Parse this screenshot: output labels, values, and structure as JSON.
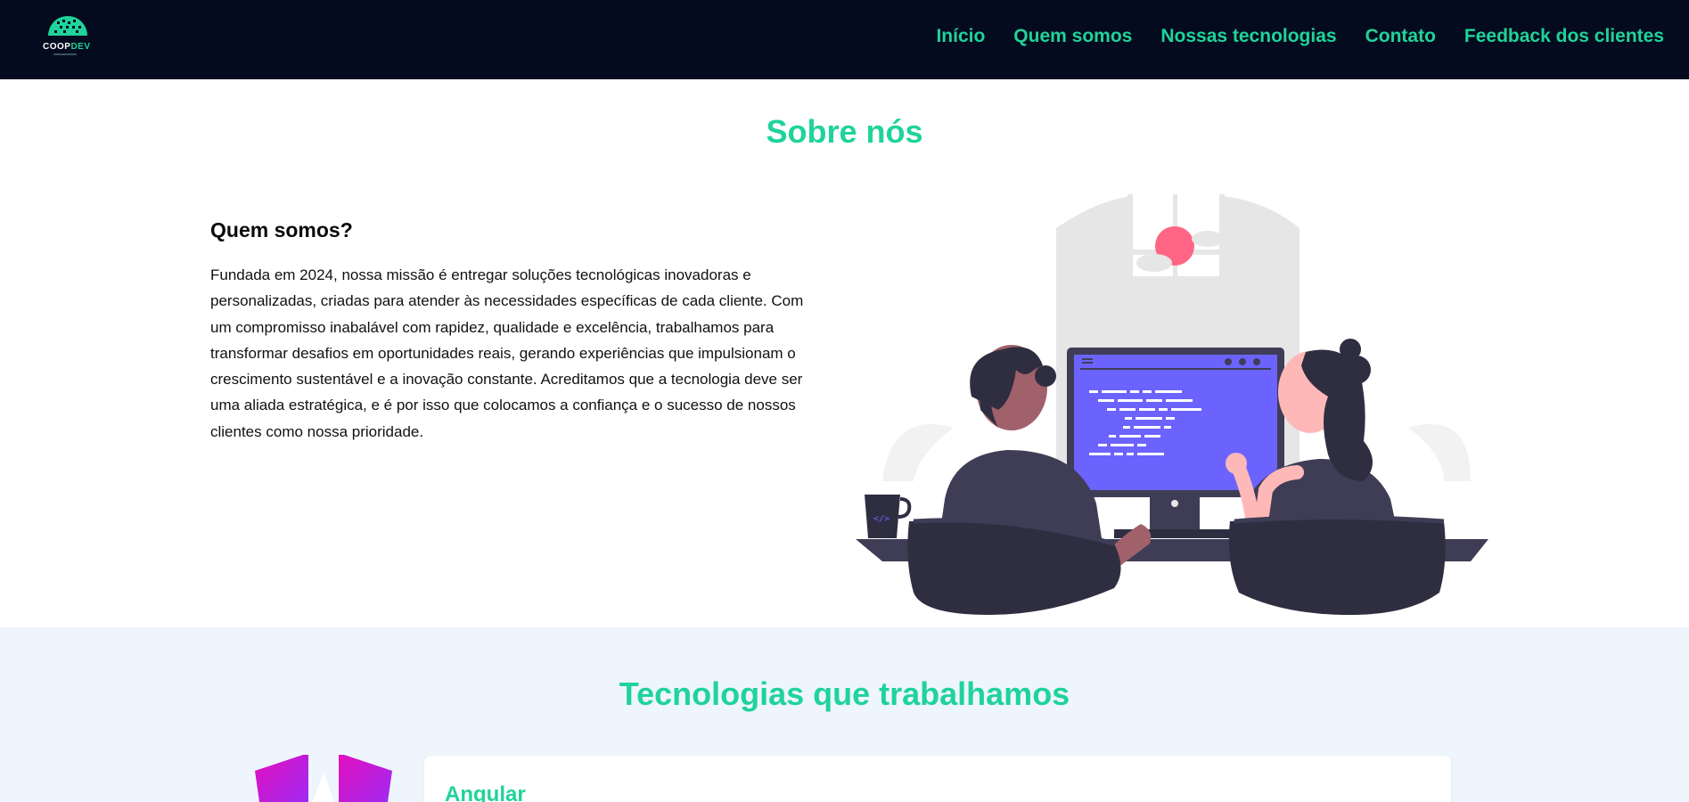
{
  "header": {
    "logo_text_main": "COOP",
    "logo_text_accent": "DEV",
    "nav": [
      "Início",
      "Quem somos",
      "Nossas tecnologias",
      "Contato",
      "Feedback dos clientes"
    ]
  },
  "about": {
    "title": "Sobre nós",
    "heading": "Quem somos?",
    "text": "Fundada em 2024, nossa missão é entregar soluções tecnológicas inovadoras e personalizadas, criadas para atender às necessidades específicas de cada cliente. Com um compromisso inabalável com rapidez, qualidade e excelência, trabalhamos para transformar desafios em oportunidades reais, gerando experiências que impulsionam o crescimento sustentável e a inovação constante. Acreditamos que a tecnologia deve ser uma aliada estratégica, e é por isso que colocamos a confiança e o sucesso de nossos clientes como nossa prioridade."
  },
  "tech": {
    "title": "Tecnologias que trabalhamos",
    "items": [
      {
        "name": "Angular",
        "icon": "angular-icon"
      }
    ]
  },
  "colors": {
    "accent": "#1fd39a",
    "header_bg": "#050b1e",
    "tech_bg": "#eef5fc",
    "screen": "#6c63ff",
    "dark": "#3f3d56",
    "sun": "#ff6584"
  },
  "icons": {
    "logo": "coopdev-logo-icon",
    "illustration": "developers-at-computer-illustration"
  }
}
